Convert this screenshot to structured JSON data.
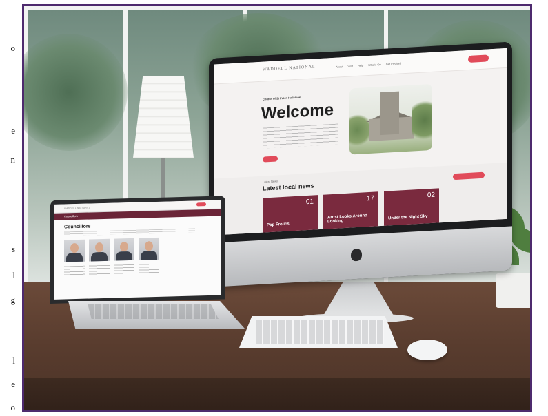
{
  "page_edge_letters": [
    "o",
    "e",
    "n",
    "s",
    "l",
    "g",
    "l",
    "e",
    "o"
  ],
  "imac_site": {
    "logo": "WADDELL NATIONAL",
    "nav_links": [
      "About",
      "Visit",
      "Help",
      "What's On",
      "Get Involved"
    ],
    "hero": {
      "kicker": "Church of St Peter, Hallstone",
      "title": "Welcome"
    },
    "news": {
      "kicker": "Latest News",
      "title": "Latest local news",
      "cards": [
        {
          "date": "01",
          "title": "Pop Frolics"
        },
        {
          "date": "17",
          "title": "Artist Looks Around Looking"
        },
        {
          "date": "02",
          "title": "Under the Night Sky"
        }
      ]
    }
  },
  "laptop_site": {
    "logo": "WADDELL NATIONAL",
    "band_label": "Councillors",
    "heading": "Councillors"
  },
  "colors": {
    "frame": "#4e2a6e",
    "accent_red": "#e14b5a",
    "news_card": "#7a2a3e"
  }
}
